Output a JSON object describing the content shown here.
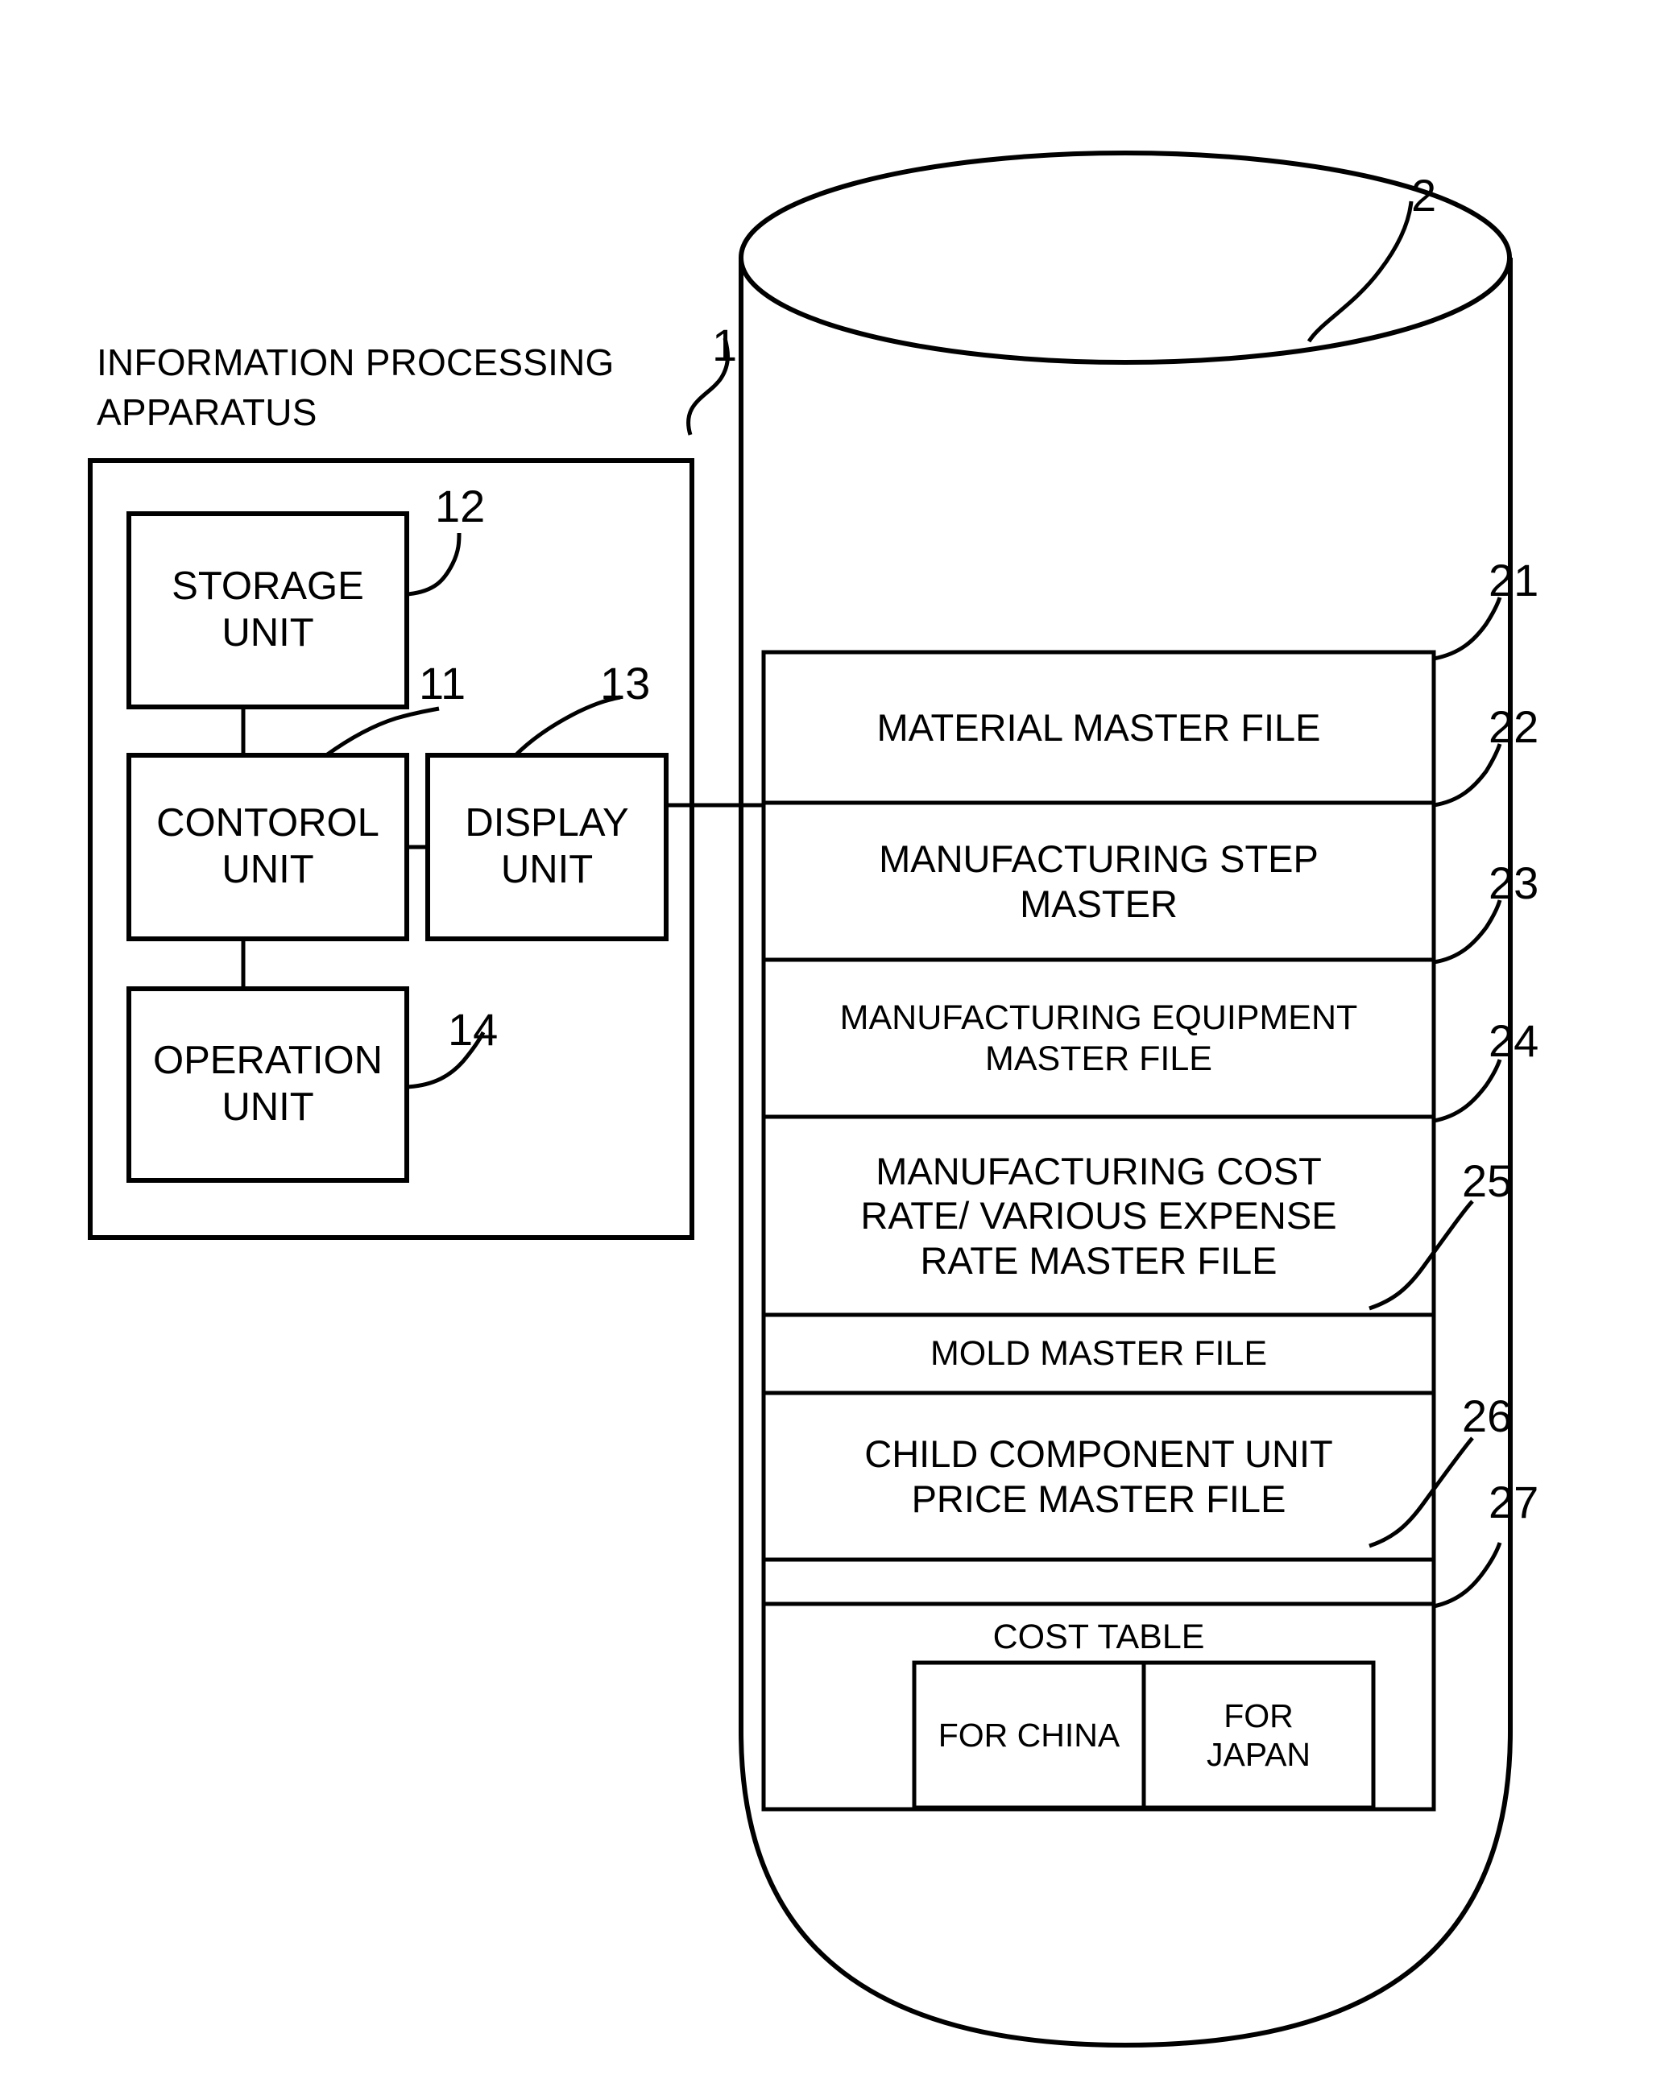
{
  "figure": {
    "apparatus_caption_line1": "INFORMATION PROCESSING",
    "apparatus_caption_line2": "APPARATUS",
    "apparatus_ref": "1",
    "database_ref": "2"
  },
  "apparatus": {
    "blocks": [
      {
        "ref": "12",
        "line1": "STORAGE",
        "line2": "UNIT"
      },
      {
        "ref": "11",
        "line1": "CONTOROL",
        "line2": "UNIT"
      },
      {
        "ref": "13",
        "line1": "DISPLAY",
        "line2": "UNIT"
      },
      {
        "ref": "14",
        "line1": "OPERATION",
        "line2": "UNIT"
      }
    ]
  },
  "database": {
    "files": [
      {
        "ref": "21",
        "line1": "MATERIAL MASTER FILE",
        "line2": ""
      },
      {
        "ref": "22",
        "line1": "MANUFACTURING STEP",
        "line2": "MASTER"
      },
      {
        "ref": "23",
        "line1": "MANUFACTURING EQUIPMENT",
        "line2": "MASTER FILE"
      },
      {
        "ref": "24",
        "line1": "MANUFACTURING COST",
        "line2": "RATE/ VARIOUS EXPENSE",
        "line3": "RATE MASTER FILE"
      },
      {
        "ref": "25",
        "line1": "MOLD MASTER FILE",
        "line2": ""
      },
      {
        "ref": "26",
        "line1": "CHILD COMPONENT UNIT",
        "line2": "PRICE MASTER FILE"
      },
      {
        "ref": "27",
        "line1": "",
        "line2": ""
      }
    ],
    "cost_table": {
      "title": "COST TABLE",
      "columns": [
        "FOR CHINA",
        "FOR JAPAN"
      ],
      "column_lines": [
        {
          "line1": "FOR CHINA",
          "line2": ""
        },
        {
          "line1": "FOR",
          "line2": "JAPAN"
        }
      ]
    }
  },
  "style": {
    "stroke": "#000000",
    "background": "#ffffff"
  }
}
